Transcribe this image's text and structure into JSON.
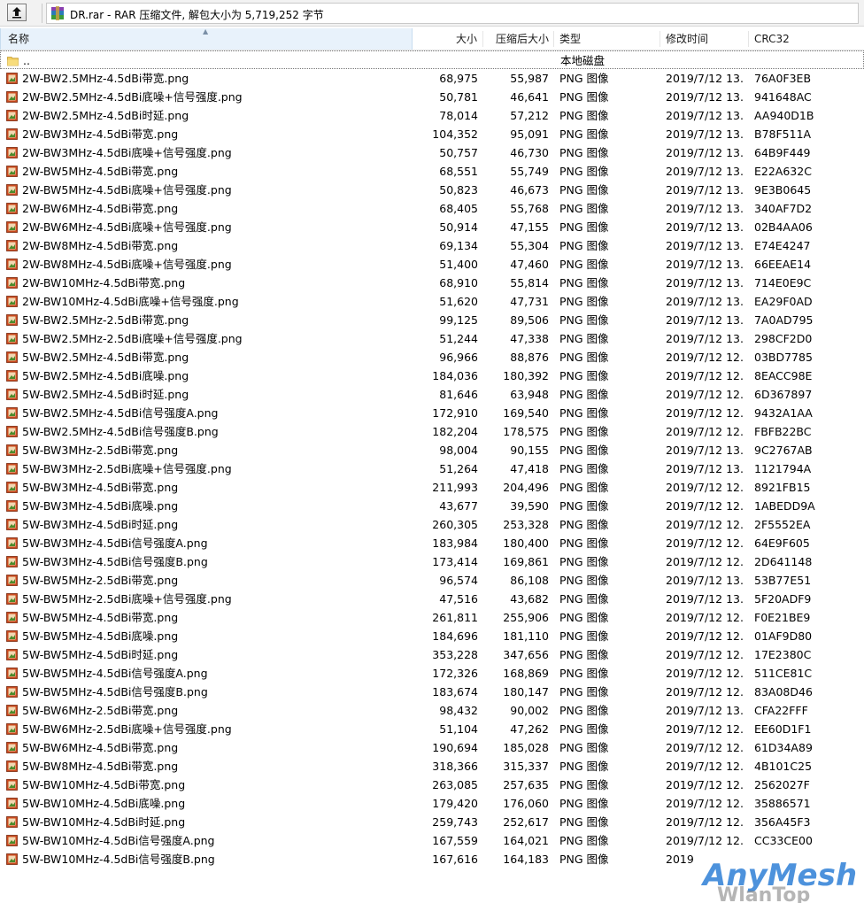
{
  "toolbar": {
    "up_button_icon": "up-arrow-icon",
    "path_text": "DR.rar - RAR 压缩文件, 解包大小为 5,719,252 字节"
  },
  "columns": {
    "name": "名称",
    "size": "大小",
    "packed": "压缩后大小",
    "type": "类型",
    "modified": "修改时间",
    "crc": "CRC32"
  },
  "parent": {
    "name": "..",
    "type": "本地磁盘"
  },
  "files": [
    {
      "name": "2W-BW2.5MHz-4.5dBi带宽.png",
      "size": "68,975",
      "packed": "55,987",
      "type": "PNG 图像",
      "modified": "2019/7/12 13...",
      "crc": "76A0F3EB"
    },
    {
      "name": "2W-BW2.5MHz-4.5dBi底噪+信号强度.png",
      "size": "50,781",
      "packed": "46,641",
      "type": "PNG 图像",
      "modified": "2019/7/12 13...",
      "crc": "941648AC"
    },
    {
      "name": "2W-BW2.5MHz-4.5dBi时延.png",
      "size": "78,014",
      "packed": "57,212",
      "type": "PNG 图像",
      "modified": "2019/7/12 13...",
      "crc": "AA940D1B"
    },
    {
      "name": "2W-BW3MHz-4.5dBi带宽.png",
      "size": "104,352",
      "packed": "95,091",
      "type": "PNG 图像",
      "modified": "2019/7/12 13...",
      "crc": "B78F511A"
    },
    {
      "name": "2W-BW3MHz-4.5dBi底噪+信号强度.png",
      "size": "50,757",
      "packed": "46,730",
      "type": "PNG 图像",
      "modified": "2019/7/12 13...",
      "crc": "64B9F449"
    },
    {
      "name": "2W-BW5MHz-4.5dBi带宽.png",
      "size": "68,551",
      "packed": "55,749",
      "type": "PNG 图像",
      "modified": "2019/7/12 13...",
      "crc": "E22A632C"
    },
    {
      "name": "2W-BW5MHz-4.5dBi底噪+信号强度.png",
      "size": "50,823",
      "packed": "46,673",
      "type": "PNG 图像",
      "modified": "2019/7/12 13...",
      "crc": "9E3B0645"
    },
    {
      "name": "2W-BW6MHz-4.5dBi带宽.png",
      "size": "68,405",
      "packed": "55,768",
      "type": "PNG 图像",
      "modified": "2019/7/12 13...",
      "crc": "340AF7D2"
    },
    {
      "name": "2W-BW6MHz-4.5dBi底噪+信号强度.png",
      "size": "50,914",
      "packed": "47,155",
      "type": "PNG 图像",
      "modified": "2019/7/12 13...",
      "crc": "02B4AA06"
    },
    {
      "name": "2W-BW8MHz-4.5dBi带宽.png",
      "size": "69,134",
      "packed": "55,304",
      "type": "PNG 图像",
      "modified": "2019/7/12 13...",
      "crc": "E74E4247"
    },
    {
      "name": "2W-BW8MHz-4.5dBi底噪+信号强度.png",
      "size": "51,400",
      "packed": "47,460",
      "type": "PNG 图像",
      "modified": "2019/7/12 13...",
      "crc": "66EEAE14"
    },
    {
      "name": "2W-BW10MHz-4.5dBi带宽.png",
      "size": "68,910",
      "packed": "55,814",
      "type": "PNG 图像",
      "modified": "2019/7/12 13...",
      "crc": "714E0E9C"
    },
    {
      "name": "2W-BW10MHz-4.5dBi底噪+信号强度.png",
      "size": "51,620",
      "packed": "47,731",
      "type": "PNG 图像",
      "modified": "2019/7/12 13...",
      "crc": "EA29F0AD"
    },
    {
      "name": "5W-BW2.5MHz-2.5dBi带宽.png",
      "size": "99,125",
      "packed": "89,506",
      "type": "PNG 图像",
      "modified": "2019/7/12 13...",
      "crc": "7A0AD795"
    },
    {
      "name": "5W-BW2.5MHz-2.5dBi底噪+信号强度.png",
      "size": "51,244",
      "packed": "47,338",
      "type": "PNG 图像",
      "modified": "2019/7/12 13...",
      "crc": "298CF2D0"
    },
    {
      "name": "5W-BW2.5MHz-4.5dBi带宽.png",
      "size": "96,966",
      "packed": "88,876",
      "type": "PNG 图像",
      "modified": "2019/7/12 12...",
      "crc": "03BD7785"
    },
    {
      "name": "5W-BW2.5MHz-4.5dBi底噪.png",
      "size": "184,036",
      "packed": "180,392",
      "type": "PNG 图像",
      "modified": "2019/7/12 12...",
      "crc": "8EACC98E"
    },
    {
      "name": "5W-BW2.5MHz-4.5dBi时延.png",
      "size": "81,646",
      "packed": "63,948",
      "type": "PNG 图像",
      "modified": "2019/7/12 12...",
      "crc": "6D367897"
    },
    {
      "name": "5W-BW2.5MHz-4.5dBi信号强度A.png",
      "size": "172,910",
      "packed": "169,540",
      "type": "PNG 图像",
      "modified": "2019/7/12 12...",
      "crc": "9432A1AA"
    },
    {
      "name": "5W-BW2.5MHz-4.5dBi信号强度B.png",
      "size": "182,204",
      "packed": "178,575",
      "type": "PNG 图像",
      "modified": "2019/7/12 12...",
      "crc": "FBFB22BC"
    },
    {
      "name": "5W-BW3MHz-2.5dBi带宽.png",
      "size": "98,004",
      "packed": "90,155",
      "type": "PNG 图像",
      "modified": "2019/7/12 13...",
      "crc": "9C2767AB"
    },
    {
      "name": "5W-BW3MHz-2.5dBi底噪+信号强度.png",
      "size": "51,264",
      "packed": "47,418",
      "type": "PNG 图像",
      "modified": "2019/7/12 13...",
      "crc": "1121794A"
    },
    {
      "name": "5W-BW3MHz-4.5dBi带宽.png",
      "size": "211,993",
      "packed": "204,496",
      "type": "PNG 图像",
      "modified": "2019/7/12 12...",
      "crc": "8921FB15"
    },
    {
      "name": "5W-BW3MHz-4.5dBi底噪.png",
      "size": "43,677",
      "packed": "39,590",
      "type": "PNG 图像",
      "modified": "2019/7/12 12...",
      "crc": "1ABEDD9A"
    },
    {
      "name": "5W-BW3MHz-4.5dBi时延.png",
      "size": "260,305",
      "packed": "253,328",
      "type": "PNG 图像",
      "modified": "2019/7/12 12...",
      "crc": "2F5552EA"
    },
    {
      "name": "5W-BW3MHz-4.5dBi信号强度A.png",
      "size": "183,984",
      "packed": "180,400",
      "type": "PNG 图像",
      "modified": "2019/7/12 12...",
      "crc": "64E9F605"
    },
    {
      "name": "5W-BW3MHz-4.5dBi信号强度B.png",
      "size": "173,414",
      "packed": "169,861",
      "type": "PNG 图像",
      "modified": "2019/7/12 12...",
      "crc": "2D641148"
    },
    {
      "name": "5W-BW5MHz-2.5dBi带宽.png",
      "size": "96,574",
      "packed": "86,108",
      "type": "PNG 图像",
      "modified": "2019/7/12 13...",
      "crc": "53B77E51"
    },
    {
      "name": "5W-BW5MHz-2.5dBi底噪+信号强度.png",
      "size": "47,516",
      "packed": "43,682",
      "type": "PNG 图像",
      "modified": "2019/7/12 13...",
      "crc": "5F20ADF9"
    },
    {
      "name": "5W-BW5MHz-4.5dBi带宽.png",
      "size": "261,811",
      "packed": "255,906",
      "type": "PNG 图像",
      "modified": "2019/7/12 12...",
      "crc": "F0E21BE9"
    },
    {
      "name": "5W-BW5MHz-4.5dBi底噪.png",
      "size": "184,696",
      "packed": "181,110",
      "type": "PNG 图像",
      "modified": "2019/7/12 12...",
      "crc": "01AF9D80"
    },
    {
      "name": "5W-BW5MHz-4.5dBi时延.png",
      "size": "353,228",
      "packed": "347,656",
      "type": "PNG 图像",
      "modified": "2019/7/12 12...",
      "crc": "17E2380C"
    },
    {
      "name": "5W-BW5MHz-4.5dBi信号强度A.png",
      "size": "172,326",
      "packed": "168,869",
      "type": "PNG 图像",
      "modified": "2019/7/12 12...",
      "crc": "511CE81C"
    },
    {
      "name": "5W-BW5MHz-4.5dBi信号强度B.png",
      "size": "183,674",
      "packed": "180,147",
      "type": "PNG 图像",
      "modified": "2019/7/12 12...",
      "crc": "83A08D46"
    },
    {
      "name": "5W-BW6MHz-2.5dBi带宽.png",
      "size": "98,432",
      "packed": "90,002",
      "type": "PNG 图像",
      "modified": "2019/7/12 13...",
      "crc": "CFA22FFF"
    },
    {
      "name": "5W-BW6MHz-2.5dBi底噪+信号强度.png",
      "size": "51,104",
      "packed": "47,262",
      "type": "PNG 图像",
      "modified": "2019/7/12 12...",
      "crc": "EE60D1F1"
    },
    {
      "name": "5W-BW6MHz-4.5dBi带宽.png",
      "size": "190,694",
      "packed": "185,028",
      "type": "PNG 图像",
      "modified": "2019/7/12 12...",
      "crc": "61D34A89"
    },
    {
      "name": "5W-BW8MHz-4.5dBi带宽.png",
      "size": "318,366",
      "packed": "315,337",
      "type": "PNG 图像",
      "modified": "2019/7/12 12...",
      "crc": "4B101C25"
    },
    {
      "name": "5W-BW10MHz-4.5dBi带宽.png",
      "size": "263,085",
      "packed": "257,635",
      "type": "PNG 图像",
      "modified": "2019/7/12 12...",
      "crc": "2562027F"
    },
    {
      "name": "5W-BW10MHz-4.5dBi底噪.png",
      "size": "179,420",
      "packed": "176,060",
      "type": "PNG 图像",
      "modified": "2019/7/12 12...",
      "crc": "35886571"
    },
    {
      "name": "5W-BW10MHz-4.5dBi时延.png",
      "size": "259,743",
      "packed": "252,617",
      "type": "PNG 图像",
      "modified": "2019/7/12 12...",
      "crc": "356A45F3"
    },
    {
      "name": "5W-BW10MHz-4.5dBi信号强度A.png",
      "size": "167,559",
      "packed": "164,021",
      "type": "PNG 图像",
      "modified": "2019/7/12 12...",
      "crc": "CC33CE00"
    },
    {
      "name": "5W-BW10MHz-4.5dBi信号强度B.png",
      "size": "167,616",
      "packed": "164,183",
      "type": "PNG 图像",
      "modified": "2019",
      "crc": ""
    }
  ],
  "watermark": {
    "line1": "AnyMesh",
    "line2": "WlanTop"
  },
  "colors": {
    "header_selected": "#e8f2fb",
    "watermark_blue": "#2e7fd6"
  }
}
